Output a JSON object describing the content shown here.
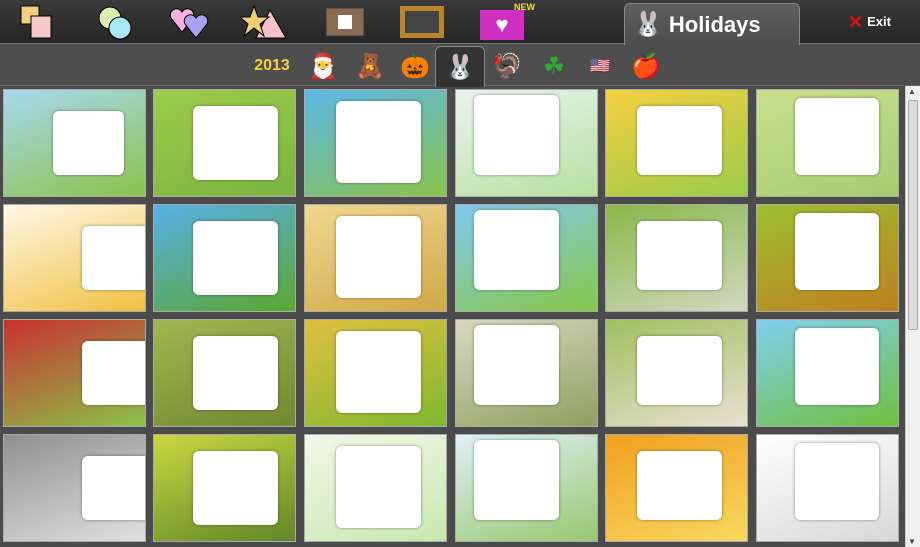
{
  "top_bar": {
    "categories": [
      {
        "name": "squares"
      },
      {
        "name": "circles"
      },
      {
        "name": "hearts"
      },
      {
        "name": "shapes"
      },
      {
        "name": "photo-frame"
      },
      {
        "name": "wood-frame"
      },
      {
        "name": "heart-frame",
        "badge": "NEW"
      }
    ],
    "active_tab": {
      "label": "Holidays"
    },
    "exit": {
      "label": "Exit",
      "icon": "x"
    }
  },
  "sub_tabs": [
    {
      "name": "new-year",
      "label": "2013"
    },
    {
      "name": "christmas",
      "icon": "santa-hat"
    },
    {
      "name": "valentine",
      "icon": "teddy-bear"
    },
    {
      "name": "halloween",
      "icon": "pumpkin"
    },
    {
      "name": "easter",
      "icon": "bunny",
      "active": true
    },
    {
      "name": "thanksgiving",
      "icon": "turkey"
    },
    {
      "name": "st-patricks",
      "icon": "clover"
    },
    {
      "name": "national",
      "icon": "flags"
    },
    {
      "name": "school",
      "icon": "apple"
    }
  ],
  "templates": [
    {
      "bg": [
        "#a8d8f0",
        "#8bc34a"
      ]
    },
    {
      "bg": [
        "#9ccc4a",
        "#7cb342"
      ]
    },
    {
      "bg": [
        "#5cb8e8",
        "#8bc34a"
      ]
    },
    {
      "bg": [
        "#e8f4f0",
        "#b8e0a0"
      ]
    },
    {
      "bg": [
        "#f4d040",
        "#9ccc4a"
      ]
    },
    {
      "bg": [
        "#c8e090",
        "#a8cc70"
      ]
    },
    {
      "bg": [
        "#fff8e8",
        "#f0c040"
      ]
    },
    {
      "bg": [
        "#58b0e8",
        "#5aa830"
      ]
    },
    {
      "bg": [
        "#f0d890",
        "#d0a848"
      ]
    },
    {
      "bg": [
        "#80c8f0",
        "#88c848"
      ]
    },
    {
      "bg": [
        "#8ab848",
        "#d0d8c0"
      ]
    },
    {
      "bg": [
        "#9cc030",
        "#c08020"
      ]
    },
    {
      "bg": [
        "#c83030",
        "#8bc34a"
      ]
    },
    {
      "bg": [
        "#a0b850",
        "#708830"
      ]
    },
    {
      "bg": [
        "#e0c040",
        "#80b830"
      ]
    },
    {
      "bg": [
        "#d8d8c0",
        "#90a060"
      ]
    },
    {
      "bg": [
        "#a0c060",
        "#e8e0d0"
      ]
    },
    {
      "bg": [
        "#80d0f0",
        "#70c040"
      ]
    },
    {
      "bg": [
        "#909090",
        "#e0e0e0"
      ]
    },
    {
      "bg": [
        "#c8d840",
        "#608828"
      ]
    },
    {
      "bg": [
        "#f0f8e8",
        "#c8e8b0"
      ]
    },
    {
      "bg": [
        "#e0f0f8",
        "#98c870"
      ]
    },
    {
      "bg": [
        "#f0a020",
        "#f8d860"
      ]
    },
    {
      "bg": [
        "#ffffff",
        "#d8d8d8"
      ]
    }
  ]
}
